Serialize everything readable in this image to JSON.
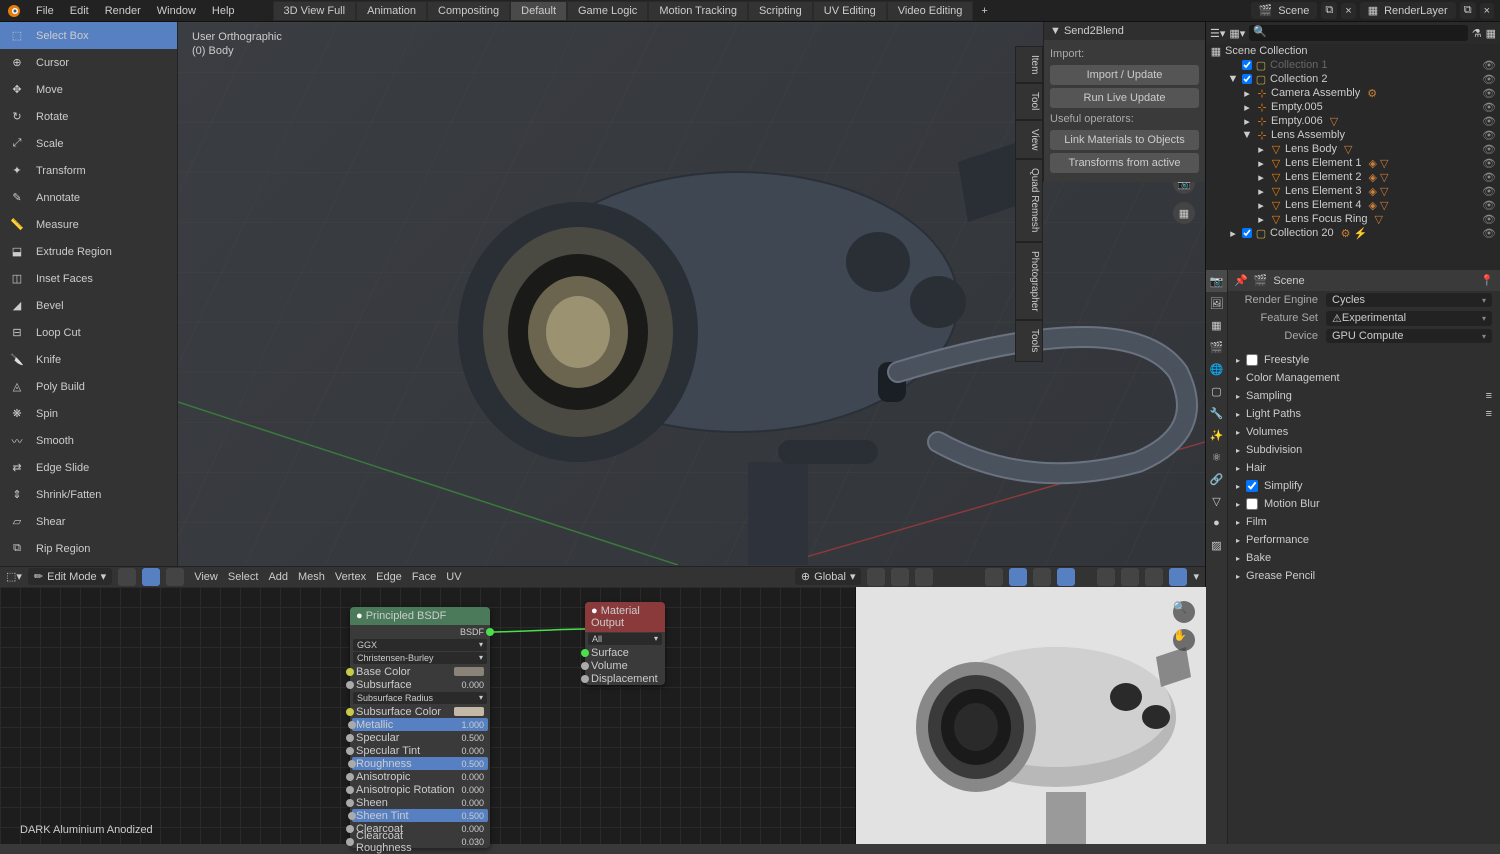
{
  "topbar": {
    "menus": [
      "File",
      "Edit",
      "Render",
      "Window",
      "Help"
    ],
    "workspaces": [
      "3D View Full",
      "Animation",
      "Compositing",
      "Default",
      "Game Logic",
      "Motion Tracking",
      "Scripting",
      "UV Editing",
      "Video Editing"
    ],
    "active_workspace": "Default",
    "scene": "Scene",
    "render_layer": "RenderLayer"
  },
  "toolbar": {
    "tools": [
      "Select Box",
      "Cursor",
      "Move",
      "Rotate",
      "Scale",
      "Transform",
      "Annotate",
      "Measure",
      "Extrude Region",
      "Inset Faces",
      "Bevel",
      "Loop Cut",
      "Knife",
      "Poly Build",
      "Spin",
      "Smooth",
      "Edge Slide",
      "Shrink/Fatten",
      "Shear",
      "Rip Region"
    ],
    "active": "Select Box"
  },
  "viewport": {
    "overlay_line1": "User Orthographic",
    "overlay_line2": "(0) Body"
  },
  "n_panel": {
    "title": "Send2Blend",
    "import_label": "Import:",
    "btn_import": "Import / Update",
    "btn_run": "Run Live Update",
    "ops_label": "Useful operators:",
    "btn_link": "Link Materials to Objects",
    "btn_transforms": "Transforms from active",
    "tabs": [
      "Item",
      "Tool",
      "View",
      "Quad Remesh",
      "Photographer",
      "Tools"
    ]
  },
  "vp_footer": {
    "mode": "Edit Mode",
    "menus": [
      "View",
      "Select",
      "Add",
      "Mesh",
      "Vertex",
      "Edge",
      "Face",
      "UV"
    ],
    "orientation": "Global"
  },
  "node_editor": {
    "material_name": "DARK Aluminium Anodized",
    "principled": {
      "title": "Principled BSDF",
      "out": "BSDF",
      "dd1": "GGX",
      "dd2": "Christensen-Burley",
      "rows": [
        {
          "name": "Base Color",
          "val": "",
          "color": "#8a8378"
        },
        {
          "name": "Subsurface",
          "val": "0.000"
        },
        {
          "name": "Subsurface Radius",
          "val": "",
          "dd": true
        },
        {
          "name": "Subsurface Color",
          "val": "",
          "color": "#c4b9a6"
        },
        {
          "name": "Metallic",
          "val": "1.000",
          "sel": true
        },
        {
          "name": "Specular",
          "val": "0.500"
        },
        {
          "name": "Specular Tint",
          "val": "0.000"
        },
        {
          "name": "Roughness",
          "val": "0.500",
          "sel": true
        },
        {
          "name": "Anisotropic",
          "val": "0.000"
        },
        {
          "name": "Anisotropic Rotation",
          "val": "0.000"
        },
        {
          "name": "Sheen",
          "val": "0.000"
        },
        {
          "name": "Sheen Tint",
          "val": "0.500",
          "sel": true
        },
        {
          "name": "Clearcoat",
          "val": "0.000"
        },
        {
          "name": "Clearcoat Roughness",
          "val": "0.030"
        }
      ]
    },
    "output": {
      "title": "Material Output",
      "dd": "All",
      "sockets": [
        "Surface",
        "Volume",
        "Displacement"
      ]
    }
  },
  "outliner": {
    "root": "Scene Collection",
    "items": [
      {
        "depth": 1,
        "expand": "",
        "check": true,
        "icon": "col",
        "name": "Collection 1",
        "coll": true,
        "disabled": true
      },
      {
        "depth": 1,
        "expand": "▼",
        "check": true,
        "icon": "col",
        "name": "Collection 2",
        "coll": true
      },
      {
        "depth": 2,
        "expand": "▸",
        "icon": "obj",
        "name": "Camera Assembly",
        "mod": "⚙"
      },
      {
        "depth": 2,
        "expand": "▸",
        "icon": "obj",
        "name": "Empty.005"
      },
      {
        "depth": 2,
        "expand": "▸",
        "icon": "obj",
        "name": "Empty.006",
        "mod": "▽"
      },
      {
        "depth": 2,
        "expand": "▼",
        "icon": "obj",
        "name": "Lens Assembly"
      },
      {
        "depth": 3,
        "expand": "▸",
        "icon": "mesh",
        "name": "Lens Body",
        "mod": "▽"
      },
      {
        "depth": 3,
        "expand": "▸",
        "icon": "mesh",
        "name": "Lens Element 1",
        "mod": "◈ ▽"
      },
      {
        "depth": 3,
        "expand": "▸",
        "icon": "mesh",
        "name": "Lens Element 2",
        "mod": "◈ ▽"
      },
      {
        "depth": 3,
        "expand": "▸",
        "icon": "mesh",
        "name": "Lens Element 3",
        "mod": "◈ ▽"
      },
      {
        "depth": 3,
        "expand": "▸",
        "icon": "mesh",
        "name": "Lens Element 4",
        "mod": "◈ ▽"
      },
      {
        "depth": 3,
        "expand": "▸",
        "icon": "mesh",
        "name": "Lens Focus Ring",
        "mod": "▽"
      },
      {
        "depth": 1,
        "expand": "▸",
        "check": true,
        "icon": "col",
        "name": "Collection 20",
        "coll": true,
        "extra": "⚙ ⚡"
      }
    ]
  },
  "properties": {
    "scene_label": "Scene",
    "render_engine_label": "Render Engine",
    "render_engine": "Cycles",
    "feature_set_label": "Feature Set",
    "feature_set": "Experimental",
    "feature_warn": "⚠",
    "device_label": "Device",
    "device": "GPU Compute",
    "sections": [
      {
        "name": "Freestyle",
        "check": false
      },
      {
        "name": "Color Management"
      },
      {
        "name": "Sampling",
        "menu": true
      },
      {
        "name": "Light Paths",
        "menu": true
      },
      {
        "name": "Volumes"
      },
      {
        "name": "Subdivision"
      },
      {
        "name": "Hair"
      },
      {
        "name": "Simplify",
        "check": true
      },
      {
        "name": "Motion Blur",
        "check": false
      },
      {
        "name": "Film"
      },
      {
        "name": "Performance"
      },
      {
        "name": "Bake"
      },
      {
        "name": "Grease Pencil"
      }
    ]
  }
}
